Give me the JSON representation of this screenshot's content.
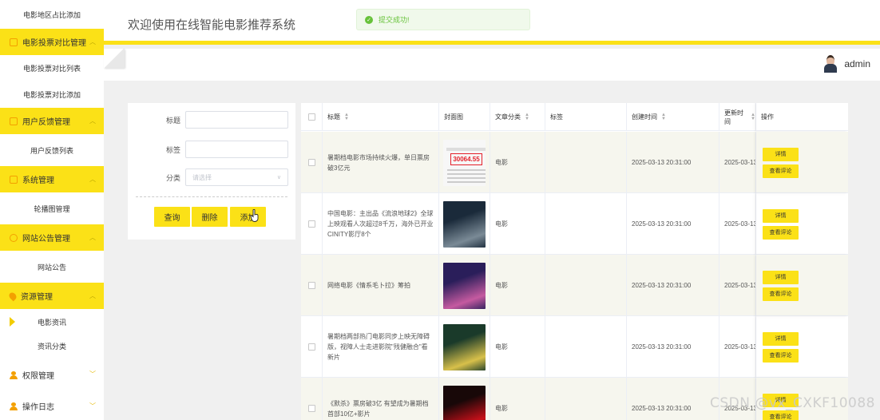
{
  "sidebar": {
    "top_item": "电影地区占比添加",
    "groups": [
      {
        "label": "电影投票对比管理",
        "icon": "calendar-icon",
        "items": [
          "电影投票对比列表",
          "电影投票对比添加"
        ]
      },
      {
        "label": "用户反馈管理",
        "icon": "calendar-icon",
        "items": [
          "用户反馈列表"
        ]
      },
      {
        "label": "系统管理",
        "icon": "calendar-icon",
        "items": [
          "轮播图管理"
        ]
      },
      {
        "label": "网站公告管理",
        "icon": "info-icon",
        "items": [
          "网站公告"
        ]
      },
      {
        "label": "资源管理",
        "icon": "location-icon",
        "items": [
          "电影资讯",
          "资讯分类"
        ]
      },
      {
        "label": "权限管理",
        "icon": "user-icon"
      },
      {
        "label": "操作日志",
        "icon": "user-icon"
      }
    ]
  },
  "header": {
    "title": "欢迎使用在线智能电影推荐系统"
  },
  "toast": {
    "message": "提交成功!"
  },
  "user": {
    "name": "admin"
  },
  "search": {
    "title_label": "标题",
    "tag_label": "标签",
    "category_label": "分类",
    "category_placeholder": "请选择",
    "query_btn": "查询",
    "delete_btn": "删除",
    "add_btn": "添加"
  },
  "table": {
    "headers": {
      "title": "标题",
      "cover": "封面图",
      "category": "文章分类",
      "tags": "标签",
      "created": "创建时间",
      "updated": "更新时间",
      "actions": "操作"
    },
    "detail_btn": "详情",
    "comments_btn": "查看评论",
    "rows": [
      {
        "title": "暑期档电影市场持续火爆，单日票房破3亿元",
        "category": "电影",
        "created": "2025-03-13 20:31:00",
        "updated": "2025-03-13",
        "thumb_colors": [
          "#f7f7f7",
          "#e4202a"
        ]
      },
      {
        "title": "中国电影：主出品《流浪地球2》全球上映观看人次超过8千万，海外已开业CINITY影厅8个",
        "category": "电影",
        "created": "2025-03-13 20:31:00",
        "updated": "2025-03-13",
        "thumb_colors": [
          "#1a2a3a",
          "#7a8a96"
        ]
      },
      {
        "title": "网络电影《情系毛卜拉》筹拍",
        "category": "电影",
        "created": "2025-03-13 20:31:00",
        "updated": "2025-03-13",
        "thumb_colors": [
          "#2a1e5a",
          "#c55aa0"
        ]
      },
      {
        "title": "暑期档两部热门电影同步上映无障碍版，视障人士走进影院\"残健融合\"看新片",
        "category": "电影",
        "created": "2025-03-13 20:31:00",
        "updated": "2025-03-13",
        "thumb_colors": [
          "#1a3a2a",
          "#d8c04a"
        ]
      },
      {
        "title": "《默杀》票房破3亿 有望成为暑期档首部10亿+影片",
        "category": "电影",
        "created": "2025-03-13 20:31:00",
        "updated": "2025-03-13",
        "thumb_colors": [
          "#180808",
          "#c8101a"
        ]
      }
    ]
  },
  "thumb_text": {
    "row1": "30064.55"
  },
  "watermark": "CSDN @vx_CXKF10088"
}
